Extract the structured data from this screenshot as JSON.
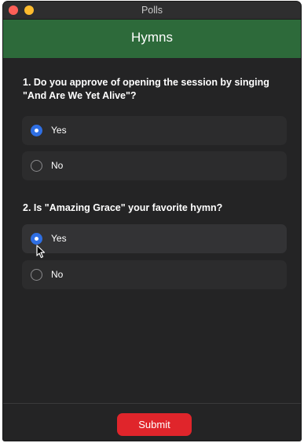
{
  "window": {
    "title": "Polls"
  },
  "header": {
    "title": "Hymns",
    "color": "#2d6a3a"
  },
  "questions": [
    {
      "number": "1.",
      "text": "1. Do you approve of opening the session by singing \"And Are We Yet Alive\"?",
      "options": [
        {
          "label": "Yes",
          "selected": true
        },
        {
          "label": "No",
          "selected": false
        }
      ]
    },
    {
      "number": "2.",
      "text": "2. Is \"Amazing Grace\" your favorite hymn?",
      "options": [
        {
          "label": "Yes",
          "selected": true
        },
        {
          "label": "No",
          "selected": false
        }
      ]
    }
  ],
  "footer": {
    "submit_label": "Submit",
    "submit_color": "#e0252b"
  },
  "colors": {
    "radio_selected": "#2f6fe3",
    "background": "#242425"
  },
  "icons": {
    "cursor": "arrow-cursor-icon"
  }
}
